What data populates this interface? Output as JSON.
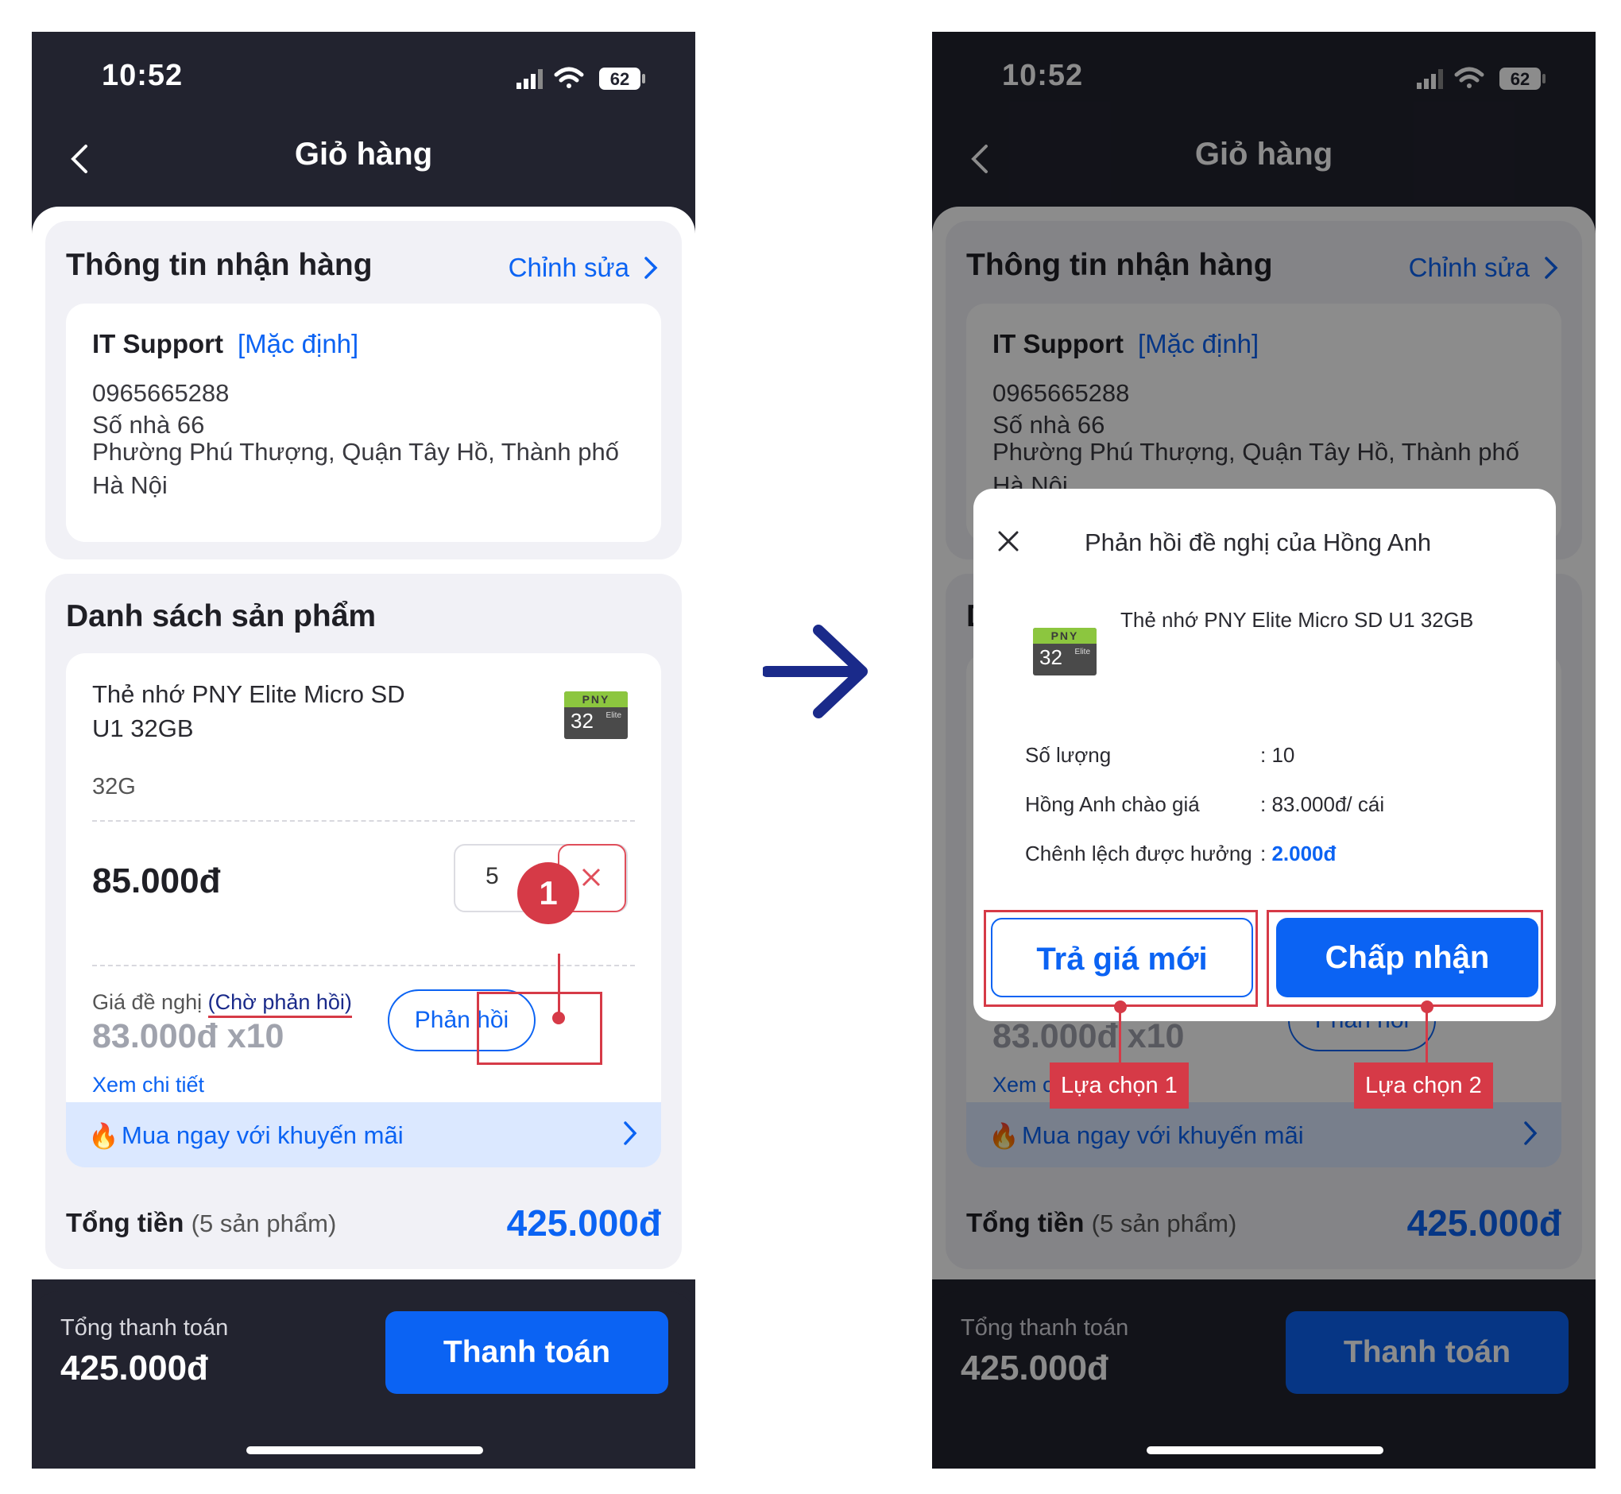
{
  "status_bar": {
    "time": "10:52",
    "battery": "62"
  },
  "header": {
    "title": "Giỏ hàng"
  },
  "receiver": {
    "section_title": "Thông tin nhận hàng",
    "edit_label": "Chỉnh sửa",
    "name": "IT Support",
    "default_tag": "[Mặc định]",
    "phone": "0965665288",
    "address_line1": "Số nhà 66",
    "address_line2": "Phường Phú Thượng, Quận Tây Hồ, Thành phố Hà Nội"
  },
  "products": {
    "section_title": "Danh sách sản phẩm",
    "item": {
      "name": "Thẻ nhớ PNY Elite Micro SD U1 32GB",
      "image_brand": "PNY",
      "image_capacity": "32",
      "image_series": "Elite",
      "variant": "32G",
      "price": "85.000đ",
      "quantity": "5",
      "offer_label": "Giá đề nghị",
      "offer_status": "(Chờ phản hồi)",
      "offer_price": "83.000đ x10",
      "detail_link": "Xem chi tiết",
      "reply_button": "Phản hồi"
    },
    "promo_text": "Mua ngay với khuyến mãi",
    "total_label": "Tổng tiền",
    "total_count": "(5 sản phẩm)",
    "total_value": "425.000đ"
  },
  "footer": {
    "total_label": "Tổng thanh toán",
    "total_value": "425.000đ",
    "pay_button": "Thanh toán"
  },
  "annotations": {
    "step_badge": "1",
    "choice1": "Lựa chọn 1",
    "choice2": "Lựa chọn 2"
  },
  "dialog": {
    "title": "Phản hồi đề nghị của Hồng Anh",
    "product_name": "Thẻ nhớ PNY Elite Micro SD U1 32GB",
    "rows": [
      {
        "key": "Số lượng",
        "value": ": 10"
      },
      {
        "key": "Hồng Anh chào giá",
        "value": ": 83.000đ/ cái"
      },
      {
        "key": "Chênh lệch được hưởng",
        "value": ": ",
        "value_highlight": "2.000đ"
      }
    ],
    "counter_button": "Trả giá mới",
    "accept_button": "Chấp nhận"
  },
  "colors": {
    "accent": "#0b63f3",
    "annotation_red": "#d63a47",
    "dark_bg": "#22232f"
  }
}
